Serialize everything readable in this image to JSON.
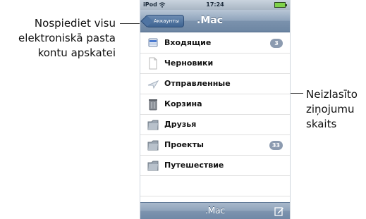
{
  "callouts": {
    "left": [
      "Nospiediet visu",
      "elektroniskā pasta",
      "kontu apskatei"
    ],
    "right": [
      "Neizlasīto",
      "ziņojumu",
      "skaits"
    ]
  },
  "status": {
    "carrier": "iPod",
    "time": "17:24",
    "wifi_icon": "wifi-icon",
    "battery_icon": "battery-icon"
  },
  "navbar": {
    "back_label": "Аккаунты",
    "title": ".Mac"
  },
  "mailboxes": [
    {
      "label": "Входящие",
      "icon": "inbox-icon",
      "badge": "3"
    },
    {
      "label": "Черновики",
      "icon": "drafts-icon",
      "badge": ""
    },
    {
      "label": "Отправленные",
      "icon": "sent-icon",
      "badge": ""
    },
    {
      "label": "Корзина",
      "icon": "trash-icon",
      "badge": ""
    },
    {
      "label": "Друзья",
      "icon": "folder-icon",
      "badge": ""
    },
    {
      "label": "Проекты",
      "icon": "folder-icon",
      "badge": "33"
    },
    {
      "label": "Путешествие",
      "icon": "folder-icon",
      "badge": ""
    }
  ],
  "toolbar": {
    "title": ".Mac",
    "compose_icon": "compose-icon"
  },
  "colors": {
    "nav_blue": "#7b92ad",
    "badge_gray": "#8c9bb0"
  }
}
